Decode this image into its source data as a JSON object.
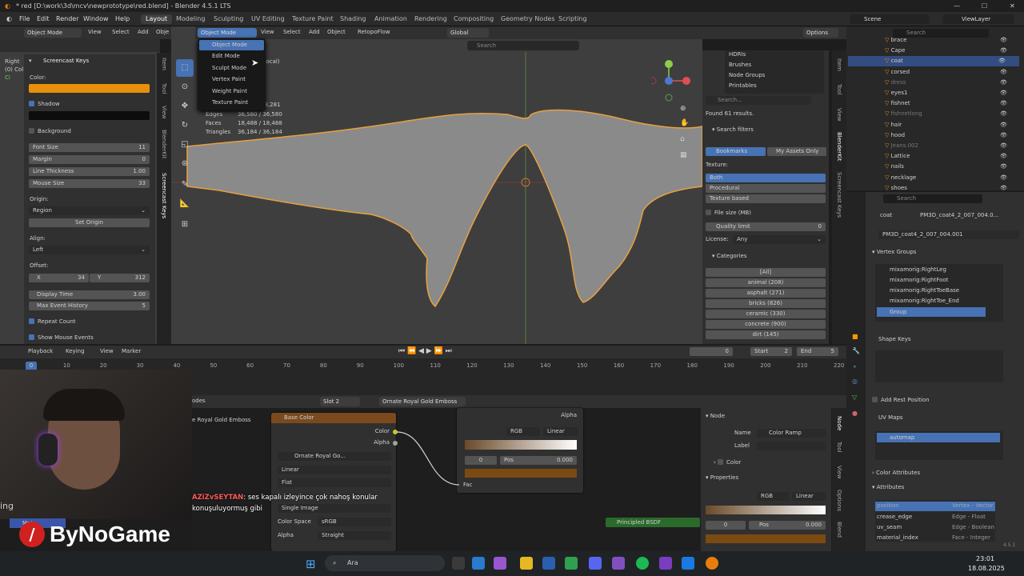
{
  "window": {
    "title": "* red [D:\\work\\3d\\mcv\\newprototype\\red.blend] - Blender 4.5.1 LTS"
  },
  "menu": {
    "items": [
      "File",
      "Edit",
      "Render",
      "Window",
      "Help"
    ],
    "workspaces": [
      "Layout",
      "Modeling",
      "Sculpting",
      "UV Editing",
      "Texture Paint",
      "Shading",
      "Animation",
      "Rendering",
      "Compositing",
      "Geometry Nodes",
      "Scripting"
    ],
    "scene": "Scene",
    "view_layer": "ViewLayer"
  },
  "left_header": {
    "mode": "Object Mode",
    "view": "View",
    "select": "Select",
    "add": "Add",
    "obj": "Obje"
  },
  "viewport_header": {
    "mode": "Object Mode",
    "view": "View",
    "select": "Select",
    "add": "Add",
    "object": "Object",
    "retopo": "RetopoFlow",
    "orientation": "Global",
    "search_placeholder": "Search",
    "options": "Options"
  },
  "mode_menu": {
    "items": [
      "Object Mode",
      "Edit Mode",
      "Sculpt Mode",
      "Vertex Paint",
      "Weight Paint",
      "Texture Paint"
    ]
  },
  "stats": {
    "local": "(Local)",
    "objects_partial": "18,281",
    "edges_label": "Edges",
    "edges": "36,580 / 36,580",
    "faces_label": "Faces",
    "faces": "18,488 / 18,488",
    "tris_label": "Triangles",
    "tris": "36,184 / 36,184"
  },
  "left_view": {
    "lines": [
      "Right",
      "(0) Col",
      "Ci"
    ]
  },
  "screencast": {
    "title": "Screencast Keys",
    "color_label": "Color:",
    "shadow": "Shadow",
    "background": "Background",
    "font_size_label": "Font Size",
    "font_size": "11",
    "margin_label": "Margin",
    "margin": "0",
    "line_thickness_label": "Line Thickness",
    "line_thickness": "1.00",
    "mouse_size_label": "Mouse Size",
    "mouse_size": "33",
    "origin_label": "Origin:",
    "origin": "Region",
    "set_origin": "Set Origin",
    "align_label": "Align:",
    "align": "Left",
    "offset_label": "Offset:",
    "x_label": "X",
    "x": "34",
    "y_label": "Y",
    "y": "312",
    "display_time_label": "Display Time",
    "display_time": "3.00",
    "max_event_label": "Max Event History",
    "max_event": "5",
    "repeat_count": "Repeat Count",
    "show_mouse": "Show Mouse Events",
    "colors": {
      "orange": "#e8900c"
    }
  },
  "side_tabs_left": [
    "Item",
    "Tool",
    "View",
    "BlenderKit",
    "Screencast Keys"
  ],
  "asset_panel": {
    "hdris": "HDRIs",
    "brushes": "Brushes",
    "node_groups": "Node Groups",
    "printables": "Printables",
    "search_placeholder": "Search...",
    "found": "Found 61 results.",
    "search_filters": "Search filters",
    "bookmarks": "Bookmarks",
    "my_assets": "My Assets Only",
    "texture_label": "Texture:",
    "texture_options": [
      "Both",
      "Procedural",
      "Texture based"
    ],
    "file_size": "File size (MB)",
    "quality_limit": "Quality limit",
    "quality_value": "0",
    "license_label": "License:",
    "license": "Any",
    "categories": "Categories",
    "cats": [
      "[All]",
      "animal (208)",
      "asphalt (271)",
      "bricks (826)",
      "ceramic (330)",
      "concrete (900)",
      "dirt (145)"
    ]
  },
  "side_tabs_right": [
    "Item",
    "Tool",
    "View",
    "BlenderKit",
    "Screencast Keys"
  ],
  "outliner": {
    "search_placeholder": "Search",
    "items": [
      "brace",
      "Cape",
      "coat",
      "corsed",
      "dress",
      "eyes1",
      "fishnet",
      "fishnetlong",
      "hair",
      "hood",
      "Jeans.002",
      "Lattice",
      "nails",
      "necklage",
      "shoes"
    ]
  },
  "properties": {
    "search_placeholder": "Search",
    "breadcrumb_obj": "coat",
    "breadcrumb_mesh": "PM3D_coat4_2_007_004.0...",
    "mesh_name": "PM3D_coat4_2_007_004.001",
    "vertex_groups": "Vertex Groups",
    "vgroups": [
      "mixamorig:RightLeg",
      "mixamorig:RightFoot",
      "mixamorig:RightToeBase",
      "mixamorig:RightToe_End",
      "Group"
    ],
    "shape_keys": "Shape Keys",
    "add_rest": "Add Rest Position",
    "uv_maps": "UV Maps",
    "uv_name": "automap",
    "color_attributes": "Color Attributes",
    "attributes": "Attributes",
    "attrs": [
      {
        "name": "position",
        "type": "Vertex - Vector"
      },
      {
        "name": "crease_edge",
        "type": "Edge - Float"
      },
      {
        "name": "uv_seam",
        "type": "Edge - Boolean"
      },
      {
        "name": "material_index",
        "type": "Face - Integer"
      }
    ],
    "version": "4.5.1"
  },
  "timeline": {
    "playback": "Playback",
    "keying": "Keying",
    "view": "View",
    "marker": "Marker",
    "current": "0",
    "start_label": "Start",
    "start": "2",
    "end_label": "End",
    "end": "5",
    "ticks": [
      "0",
      "10",
      "20",
      "30",
      "40",
      "50",
      "60",
      "70",
      "80",
      "90",
      "100",
      "110",
      "120",
      "130",
      "140",
      "150",
      "160",
      "170",
      "180",
      "190",
      "200",
      "210",
      "220"
    ]
  },
  "node_editor": {
    "nodes_label": "odes",
    "slot": "Slot 2",
    "material": "Ornate Royal Gold Emboss",
    "mat_label": "e Royal Gold Emboss",
    "base_color": "Base Color",
    "out_color": "Color",
    "out_alpha": "Alpha",
    "image_name": "Ornate Royal Go...",
    "interp": "Linear",
    "projection": "Flat",
    "extension": "Single Image",
    "color_space_label": "Color Space",
    "color_space": "sRGB",
    "alpha_label": "Alpha",
    "alpha_mode": "Straight",
    "ramp_mode": "RGB",
    "ramp_interp": "Linear",
    "ramp_pos_idx": "0",
    "ramp_pos_label": "Pos",
    "ramp_pos": "0.000",
    "ramp_alpha": "Alpha",
    "ramp_fac": "Fac",
    "principled": "Principled BSDF"
  },
  "node_sidebar": {
    "node": "Node",
    "name_label": "Name",
    "name": "Color Ramp",
    "label_label": "Label",
    "color": "Color",
    "properties": "Properties",
    "mode": "RGB",
    "interp": "Linear",
    "pos_idx": "0",
    "pos_label": "Pos",
    "pos": "0.000",
    "tabs": [
      "Node",
      "Tool",
      "View",
      "Options",
      "Blend"
    ]
  },
  "chat": {
    "user": "AZiZvSEYTAN",
    "message": ": ses kapalı izleyince çok nahoş konular konuşuluyormuş gibi"
  },
  "brand": {
    "logo_text": "ByNoGame",
    "left_text": "ing",
    "blue_label": "Mat"
  },
  "taskbar": {
    "search": "Ara",
    "time": "23:01",
    "date": "18.08.2025"
  }
}
